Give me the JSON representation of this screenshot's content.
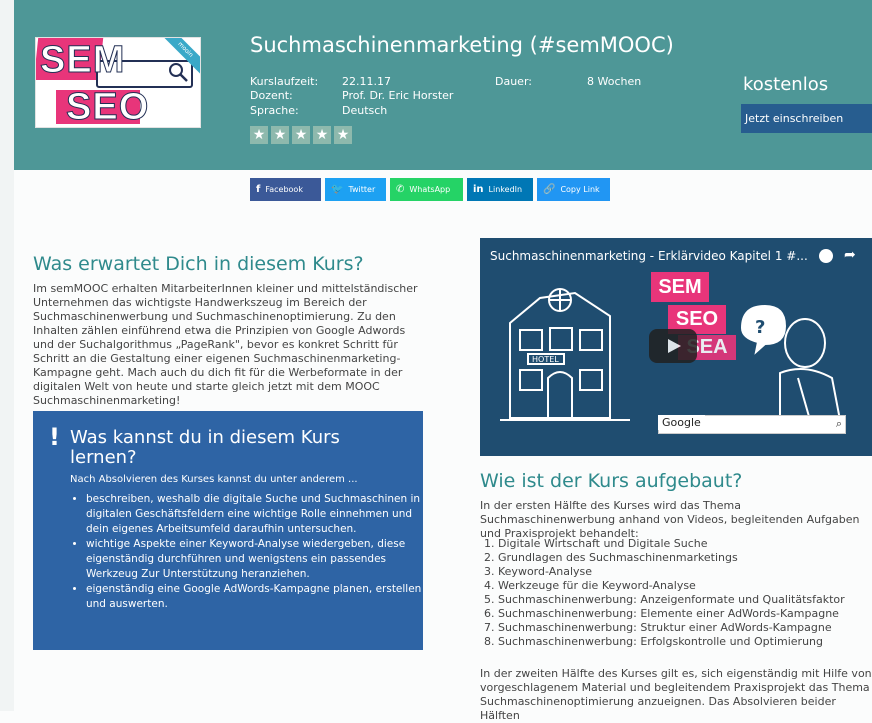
{
  "course": {
    "title": "Suchmaschinenmarketing (#semMOOC)",
    "labels": {
      "runtime": "Kurslaufzeit:",
      "lecturer": "Dozent:",
      "language": "Sprache:",
      "duration": "Dauer:"
    },
    "values": {
      "runtime": "22.11.17",
      "lecturer": "Prof. Dr. Eric Horster",
      "language": "Deutsch",
      "duration": "8 Wochen"
    },
    "rating_stars": 5,
    "price": "kostenlos",
    "enroll_label": "Jetzt einschreiben"
  },
  "logo": {
    "sem": "SEM",
    "seo": "SEO",
    "badge": "mooin"
  },
  "share": [
    {
      "label": "Facebook",
      "icon": "facebook-icon",
      "glyph": "f",
      "color": "#3b5998"
    },
    {
      "label": "Twitter",
      "icon": "twitter-icon",
      "glyph": "🐦",
      "color": "#1da1f2"
    },
    {
      "label": "WhatsApp",
      "icon": "whatsapp-icon",
      "glyph": "✆",
      "color": "#25d366"
    },
    {
      "label": "LinkedIn",
      "icon": "linkedin-icon",
      "glyph": "in",
      "color": "#0077b5"
    },
    {
      "label": "Copy Link",
      "icon": "link-icon",
      "glyph": "🔗",
      "color": "#2196f3"
    }
  ],
  "left": {
    "heading": "Was erwartet Dich in diesem Kurs?",
    "intro": "Im semMOOC erhalten MitarbeiterInnen kleiner und mittelständischer Unternehmen das wichtigste Handwerkszeug im Bereich der Suchmaschinenwerbung und Suchmaschinenoptimierung. Zu den Inhalten zählen einführend etwa die Prinzipien von Google Adwords und der Suchalgorithmus „PageRank\", bevor es konkret Schritt für Schritt an die Gestaltung einer eigenen Suchmaschinenmarketing-Kampagne geht. Mach auch du dich fit für die Werbeformate in der digitalen Welt von heute und starte gleich jetzt mit dem MOOC Suchmaschinenmarketing!",
    "learn": {
      "mark": "!",
      "heading": "Was kannst du in diesem Kurs lernen?",
      "lead": "Nach Absolvieren des Kurses kannst du unter anderem ...",
      "items": [
        "beschreiben, weshalb die digitale Suche und Suchmaschinen in digitalen Geschäftsfeldern eine wichtige Rolle einnehmen und dein eigenes Arbeitsumfeld daraufhin untersuchen.",
        "wichtige Aspekte einer Keyword-Analyse wiedergeben, diese eigenständig durchführen und wenigstens ein passendes Werkzeug Zur Unterstützung heranziehen.",
        "eigenständig eine Google AdWords-Kampagne planen, erstellen und auswerten."
      ]
    }
  },
  "video": {
    "title": "Suchmaschinenmarketing - Erklärvideo Kapitel 1 #...",
    "sem": "SEM",
    "seo": "SEO",
    "sea": "SEA",
    "google": "Google"
  },
  "right": {
    "heading": "Wie ist der Kurs aufgebaut?",
    "para1": "In der ersten Hälfte des Kurses wird das Thema Suchmaschinenwerbung anhand von Videos, begleitenden Aufgaben und Praxisprojekt behandelt:",
    "list": [
      "Digitale Wirtschaft und Digitale Suche",
      "Grundlagen des Suchmaschinenmarketings",
      "Keyword-Analyse",
      "Werkzeuge für die Keyword-Analyse",
      "Suchmaschinenwerbung: Anzeigenformate und Qualitätsfaktor",
      "Suchmaschinenwerbung: Elemente einer AdWords-Kampagne",
      "Suchmaschinenwerbung: Struktur einer AdWords-Kampagne",
      "Suchmaschinenwerbung: Erfolgskontrolle und Optimierung"
    ],
    "para2": "In der zweiten Hälfte des Kurses gilt es, sich eigenständig mit Hilfe von vorgeschlagenem Material und begleitendem Praxisprojekt das Thema Suchmaschinenoptimierung anzueignen. Das Absolvieren beider Hälften"
  }
}
